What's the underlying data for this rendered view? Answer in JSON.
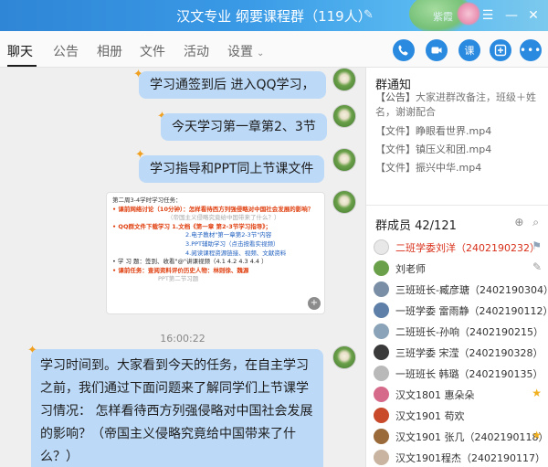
{
  "window": {
    "title": "汉文专业 纲要课程群",
    "member_count": "（119人）",
    "user_label": "紫霞"
  },
  "tabs": [
    {
      "label": "聊天",
      "active": true
    },
    {
      "label": "公告"
    },
    {
      "label": "相册"
    },
    {
      "label": "文件"
    },
    {
      "label": "活动"
    },
    {
      "label": "设置"
    }
  ],
  "toolbar_icons": [
    "phone-icon",
    "video-icon",
    "lesson-icon",
    "add-app-icon",
    "more-icon"
  ],
  "chat": {
    "messages": [
      {
        "text": "学习通签到后 进入QQ学习，"
      },
      {
        "text": "今天学习第一章第2、3节"
      },
      {
        "text": "学习指导和PPT同上节课文件"
      }
    ],
    "image_card": {
      "lines": [
        "第二周3-4学时学习任务：",
        "• 课前网络讨论（10分钟）：怎样看待西方列强侵略对中国社会发展的影响？",
        "（帝国主义侵略究竟给中国带来了什么？）",
        "• QQ群文件下载学习   1.文档《第一章  第2-3节学习指导》；",
        "2.电子教材\"第一章第2-3节\"内容",
        "3.PPT辅助学习（点击按看实视频）",
        "4.阅读课程资源链接、视频、文献资料",
        "• 学 习 题：签到、收看\"@\"讲课视频（4.1  4.2  4.3  4.4 ）",
        "• 课前任务：查阅资料评价历史人物：林则徐、魏源",
        "PPT第二节习题"
      ]
    },
    "timestamp": "16:00:22",
    "long_message": "学习时间到。大家看到今天的任务，在自主学习之前，我们通过下面问题来了解同学们上节课学习情况：                         怎样看待西方列强侵略对中国社会发展的影响？（帝国主义侵略究竟给中国带来了什么？）"
  },
  "notice": {
    "title": "群通知",
    "announcement_tag": "【公告】",
    "announcement": "大家进群改备注，班级＋姓名，谢谢配合",
    "files": [
      {
        "tag": "【文件】",
        "name": "睁眼看世界.mp4"
      },
      {
        "tag": "【文件】",
        "name": "镇压义和团.mp4"
      },
      {
        "tag": "【文件】",
        "name": "振兴中华.mp4"
      }
    ]
  },
  "members": {
    "title": "群成员 42/121",
    "list": [
      {
        "name": "二班学委刘洋（2402190232）",
        "badge": "owner",
        "avatar_color": "#e8e8e8"
      },
      {
        "name": "刘老师",
        "badge": "edit",
        "avatar_color": "#6ba04a"
      },
      {
        "name": "三班班长-臧彦瑭（2402190304）",
        "badge": "",
        "avatar_color": "#7a8fa6"
      },
      {
        "name": "一班学委 雷雨静（2402190112）",
        "badge": "",
        "avatar_color": "#5d7fa8"
      },
      {
        "name": "二班班长-孙响（2402190215）",
        "badge": "",
        "avatar_color": "#8aa3b8"
      },
      {
        "name": "三班学委 宋滢（2402190328）",
        "badge": "",
        "avatar_color": "#3a3a3a"
      },
      {
        "name": "一班班长      韩璐（2402190135）",
        "badge": "",
        "avatar_color": "#b9b9b9"
      },
      {
        "name": "汉文1801 惠朵朵",
        "badge": "star",
        "avatar_color": "#d66a8a"
      },
      {
        "name": "汉文1901  苟欢",
        "badge": "",
        "avatar_color": "#c84a2a"
      },
      {
        "name": "汉文1901 张几（2402190118）",
        "badge": "star",
        "avatar_color": "#9a6a3a"
      },
      {
        "name": "汉文1901程杰（2402190117）",
        "badge": "",
        "avatar_color": "#c8b4a0"
      }
    ]
  }
}
